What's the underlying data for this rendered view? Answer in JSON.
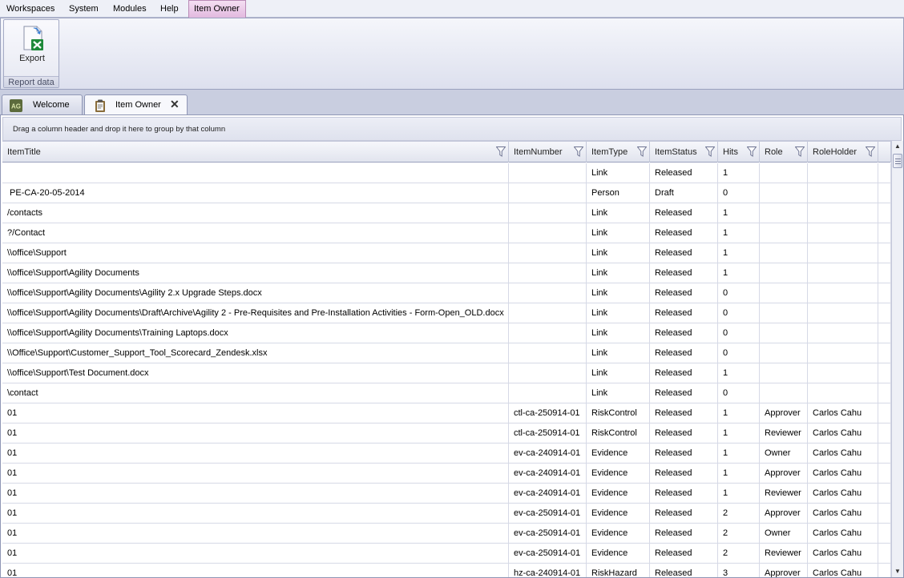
{
  "menubar": {
    "items": [
      "Workspaces",
      "System",
      "Modules",
      "Help",
      "Item Owner"
    ]
  },
  "ribbon": {
    "export_label": "Export",
    "group_label": "Report data"
  },
  "tabs": [
    {
      "label": "Welcome",
      "icon": "agility-logo-icon"
    },
    {
      "label": "Item Owner",
      "icon": "clipboard-icon",
      "close": "✕"
    }
  ],
  "grid": {
    "group_hint": "Drag a column header and drop it here to group by that column",
    "columns": [
      "ItemTitle",
      "ItemNumber",
      "ItemType",
      "ItemStatus",
      "Hits",
      "Role",
      "RoleHolder"
    ],
    "rows": [
      [
        "",
        "",
        "Link",
        "Released",
        "1",
        "",
        ""
      ],
      [
        " PE-CA-20-05-2014",
        "",
        "Person",
        "Draft",
        "0",
        "",
        ""
      ],
      [
        "/contacts",
        "",
        "Link",
        "Released",
        "1",
        "",
        ""
      ],
      [
        "?/Contact",
        "",
        "Link",
        "Released",
        "1",
        "",
        ""
      ],
      [
        "\\\\office\\Support",
        "",
        "Link",
        "Released",
        "1",
        "",
        ""
      ],
      [
        "\\\\office\\Support\\Agility Documents",
        "",
        "Link",
        "Released",
        "1",
        "",
        ""
      ],
      [
        "\\\\office\\Support\\Agility Documents\\Agility 2.x Upgrade Steps.docx",
        "",
        "Link",
        "Released",
        "0",
        "",
        ""
      ],
      [
        "\\\\office\\Support\\Agility Documents\\Draft\\Archive\\Agility 2 - Pre-Requisites and Pre-Installation Activities - Form-Open_OLD.docx",
        "",
        "Link",
        "Released",
        "0",
        "",
        ""
      ],
      [
        "\\\\office\\Support\\Agility Documents\\Training Laptops.docx",
        "",
        "Link",
        "Released",
        "0",
        "",
        ""
      ],
      [
        "\\\\Office\\Support\\Customer_Support_Tool_Scorecard_Zendesk.xlsx",
        "",
        "Link",
        "Released",
        "0",
        "",
        ""
      ],
      [
        "\\\\office\\Support\\Test Document.docx",
        "",
        "Link",
        "Released",
        "1",
        "",
        ""
      ],
      [
        "\\contact",
        "",
        "Link",
        "Released",
        "0",
        "",
        ""
      ],
      [
        "01",
        "ctl-ca-250914-01",
        "RiskControl",
        "Released",
        "1",
        "Approver",
        "Carlos Cahu"
      ],
      [
        "01",
        "ctl-ca-250914-01",
        "RiskControl",
        "Released",
        "1",
        "Reviewer",
        "Carlos Cahu"
      ],
      [
        "01",
        "ev-ca-240914-01",
        "Evidence",
        "Released",
        "1",
        "Owner",
        "Carlos Cahu"
      ],
      [
        "01",
        "ev-ca-240914-01",
        "Evidence",
        "Released",
        "1",
        "Approver",
        "Carlos Cahu"
      ],
      [
        "01",
        "ev-ca-240914-01",
        "Evidence",
        "Released",
        "1",
        "Reviewer",
        "Carlos Cahu"
      ],
      [
        "01",
        "ev-ca-250914-01",
        "Evidence",
        "Released",
        "2",
        "Approver",
        "Carlos Cahu"
      ],
      [
        "01",
        "ev-ca-250914-01",
        "Evidence",
        "Released",
        "2",
        "Owner",
        "Carlos Cahu"
      ],
      [
        "01",
        "ev-ca-250914-01",
        "Evidence",
        "Released",
        "2",
        "Reviewer",
        "Carlos Cahu"
      ],
      [
        "01",
        "hz-ca-240914-01",
        "RiskHazard",
        "Released",
        "3",
        "Approver",
        "Carlos Cahu"
      ]
    ]
  },
  "colors": {
    "active_menu": "#e2b9df",
    "chrome": "#c9cee0",
    "grid_line": "#d6d9e6"
  }
}
